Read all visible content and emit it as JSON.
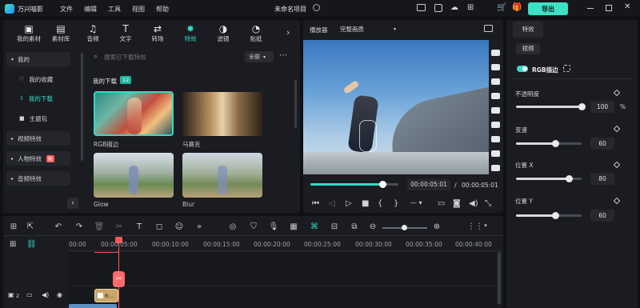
{
  "app": {
    "name": "万兴喵影",
    "project_title": "未命名项目"
  },
  "menu": [
    "文件",
    "编辑",
    "工具",
    "视图",
    "帮助"
  ],
  "header": {
    "export_label": "导出"
  },
  "media_tabs": [
    {
      "label": "我的素材",
      "icon": "folder-icon"
    },
    {
      "label": "素材库",
      "icon": "library-icon"
    },
    {
      "label": "音频",
      "icon": "music-icon"
    },
    {
      "label": "文字",
      "icon": "text-icon"
    },
    {
      "label": "转场",
      "icon": "transition-icon"
    },
    {
      "label": "特效",
      "icon": "effects-icon"
    },
    {
      "label": "滤镜",
      "icon": "filter-icon"
    },
    {
      "label": "贴纸",
      "icon": "sticker-icon"
    }
  ],
  "sidebar": {
    "items": [
      {
        "label": "我的"
      },
      {
        "label": "我的收藏"
      },
      {
        "label": "我的下载"
      },
      {
        "label": "主题包"
      },
      {
        "label": "视频特效"
      },
      {
        "label": "人物特效",
        "badge": "新"
      },
      {
        "label": "音频特效"
      }
    ]
  },
  "search": {
    "placeholder": "搜索已下载特效",
    "filter": "全部"
  },
  "downloads": {
    "title": "我的下载",
    "count": "12"
  },
  "thumbs": [
    {
      "label": "RGB描边"
    },
    {
      "label": "马赛克"
    },
    {
      "label": "Glow"
    },
    {
      "label": "Blur"
    }
  ],
  "player": {
    "label": "播放器",
    "quality": "完整画质",
    "current_time": "00:00:05:01",
    "total_time": "00:00:05:01",
    "separator": "/",
    "progress": 0.82
  },
  "props": {
    "tab": "特效",
    "subtab": "视频",
    "effect_name": "RGB描边",
    "params": [
      {
        "label": "不透明度",
        "value": "100",
        "unit": "%",
        "level": 1.0
      },
      {
        "label": "变速",
        "value": "60",
        "unit": "",
        "level": 0.6
      },
      {
        "label": "位置 X",
        "value": "80",
        "unit": "",
        "level": 0.8
      },
      {
        "label": "位置 Y",
        "value": "60",
        "unit": "",
        "level": 0.6
      }
    ]
  },
  "timeline": {
    "ruler": [
      "00:00",
      "00:00:05:00",
      "00:00:10:00",
      "00:00:15:00",
      "00:00:20:00",
      "00:00:25:00",
      "00:00:30:00",
      "00:00:35:00",
      "00:00:40:00"
    ],
    "track_number": "2",
    "clip_label": "R..."
  },
  "colors": {
    "accent": "#35d9c5",
    "export": "#3fe0c5",
    "bg": "#101114"
  }
}
